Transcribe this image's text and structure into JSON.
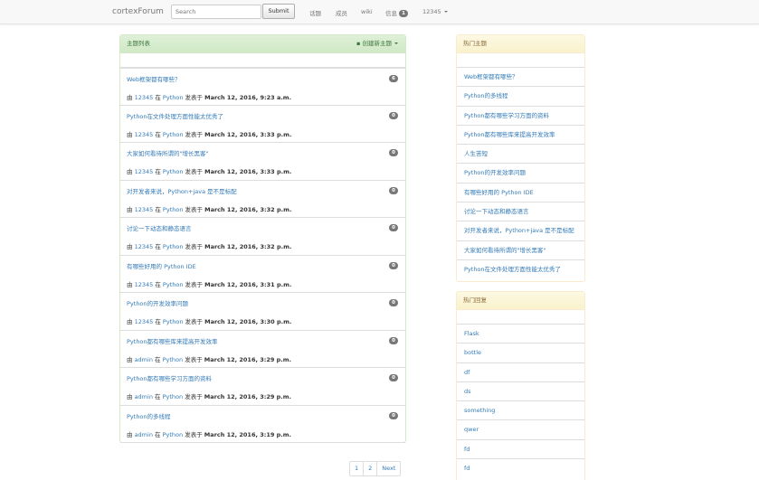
{
  "navbar": {
    "brand": "cortexForum",
    "search_placeholder": "Search",
    "submit_label": "Submit",
    "nav_topics": "话题",
    "nav_members": "成员",
    "nav_wiki": "wiki",
    "nav_messages": "信息",
    "messages_badge": "1",
    "user": "12345"
  },
  "main_panel": {
    "title": "主题列表",
    "create_label": "创建新主题",
    "topics": [
      {
        "title": "Web框架都有哪些？",
        "count": "6",
        "by": "由",
        "author": "12345",
        "in": "在",
        "category": "Python",
        "posted": "发表于",
        "date": "March 12, 2016, 9:23 a.m."
      },
      {
        "title": "Python在文件处理方面性能太优秀了",
        "count": "0",
        "by": "由",
        "author": "12345",
        "in": "在",
        "category": "Python",
        "posted": "发表于",
        "date": "March 12, 2016, 3:33 p.m."
      },
      {
        "title": "大家如何看待所谓的\"增长黑客\"",
        "count": "0",
        "by": "由",
        "author": "12345",
        "in": "在",
        "category": "Python",
        "posted": "发表于",
        "date": "March 12, 2016, 3:33 p.m."
      },
      {
        "title": "对开发者来说，Python+java 是不是标配",
        "count": "0",
        "by": "由",
        "author": "12345",
        "in": "在",
        "category": "Python",
        "posted": "发表于",
        "date": "March 12, 2016, 3:32 p.m."
      },
      {
        "title": "讨论一下动态和静态语言",
        "count": "0",
        "by": "由",
        "author": "12345",
        "in": "在",
        "category": "Python",
        "posted": "发表于",
        "date": "March 12, 2016, 3:32 p.m."
      },
      {
        "title": "有哪些好用的 Python IDE",
        "count": "0",
        "by": "由",
        "author": "12345",
        "in": "在",
        "category": "Python",
        "posted": "发表于",
        "date": "March 12, 2016, 3:31 p.m."
      },
      {
        "title": "Python的开发效率问题",
        "count": "0",
        "by": "由",
        "author": "12345",
        "in": "在",
        "category": "Python",
        "posted": "发表于",
        "date": "March 12, 2016, 3:30 p.m."
      },
      {
        "title": "Python都有哪些库来提高开发效率",
        "count": "0",
        "by": "由",
        "author": "admin",
        "in": "在",
        "category": "Python",
        "posted": "发表于",
        "date": "March 12, 2016, 3:29 p.m."
      },
      {
        "title": "Python都有哪些学习方面的资料",
        "count": "0",
        "by": "由",
        "author": "admin",
        "in": "在",
        "category": "Python",
        "posted": "发表于",
        "date": "March 12, 2016, 3:29 p.m."
      },
      {
        "title": "Python的多线程",
        "count": "0",
        "by": "由",
        "author": "admin",
        "in": "在",
        "category": "Python",
        "posted": "发表于",
        "date": "March 12, 2016, 3:19 p.m."
      }
    ]
  },
  "pagination": {
    "p1": "1",
    "p2": "2",
    "next": "Next"
  },
  "hot_topics": {
    "title": "热门主题",
    "items": [
      "Web框架都有哪些？",
      "Python的多线程",
      "Python都有哪些学习方面的资料",
      "Python都有哪些库来提高开发效率",
      "人生苦短",
      "Python的开发效率问题",
      "有哪些好用的 Python IDE",
      "讨论一下动态和静态语言",
      "对开发者来说，Python+java 是不是标配",
      "大家如何看待所谓的\"增长黑客\"",
      "Python在文件处理方面性能太优秀了"
    ]
  },
  "hot_replies": {
    "title": "热门回复",
    "items": [
      "Flask",
      "bottle",
      "df",
      "ds",
      "something",
      "qwer",
      "fd",
      "fd"
    ]
  }
}
